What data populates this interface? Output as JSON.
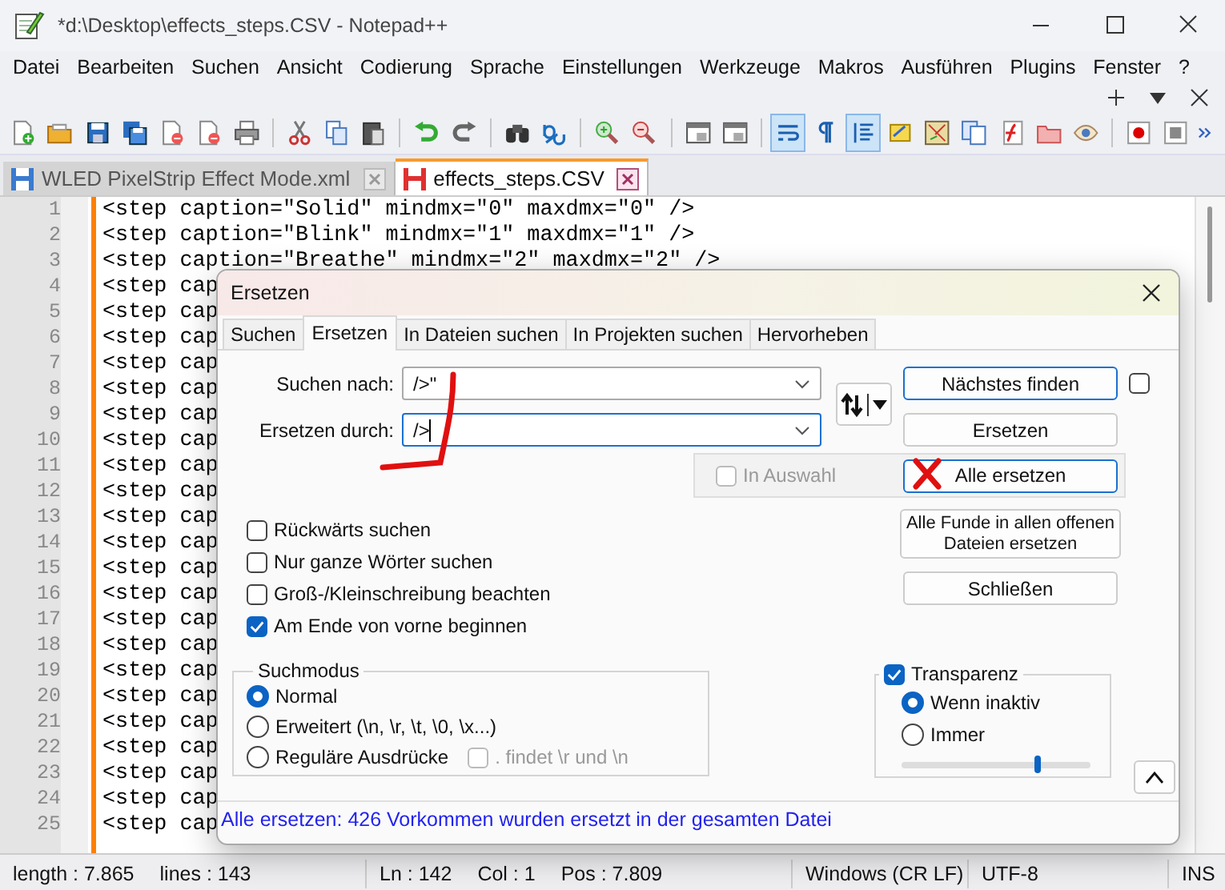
{
  "window": {
    "title": "*d:\\Desktop\\effects_steps.CSV - Notepad++"
  },
  "menu": [
    "Datei",
    "Bearbeiten",
    "Suchen",
    "Ansicht",
    "Codierung",
    "Sprache",
    "Einstellungen",
    "Werkzeuge",
    "Makros",
    "Ausführen",
    "Plugins",
    "Fenster",
    "?"
  ],
  "file_tabs": [
    {
      "label": "WLED PixelStrip Effect Mode.xml",
      "selected": false
    },
    {
      "label": "effects_steps.CSV",
      "selected": true
    }
  ],
  "editor": {
    "lines": [
      {
        "number": "1",
        "text": "<step caption=\"Solid\" mindmx=\"0\" maxdmx=\"0\" />"
      },
      {
        "number": "2",
        "text": "<step caption=\"Blink\" mindmx=\"1\" maxdmx=\"1\" />"
      },
      {
        "number": "3",
        "text": "<step caption=\"Breathe\" mindmx=\"2\" maxdmx=\"2\" />"
      },
      {
        "number": "4",
        "text": "<step cap"
      },
      {
        "number": "5",
        "text": "<step cap"
      },
      {
        "number": "6",
        "text": "<step cap"
      },
      {
        "number": "7",
        "text": "<step cap"
      },
      {
        "number": "8",
        "text": "<step cap"
      },
      {
        "number": "9",
        "text": "<step cap"
      },
      {
        "number": "10",
        "text": "<step cap"
      },
      {
        "number": "11",
        "text": "<step cap"
      },
      {
        "number": "12",
        "text": "<step cap"
      },
      {
        "number": "13",
        "text": "<step cap"
      },
      {
        "number": "14",
        "text": "<step cap"
      },
      {
        "number": "15",
        "text": "<step cap"
      },
      {
        "number": "16",
        "text": "<step cap"
      },
      {
        "number": "17",
        "text": "<step cap"
      },
      {
        "number": "18",
        "text": "<step cap"
      },
      {
        "number": "19",
        "text": "<step cap"
      },
      {
        "number": "20",
        "text": "<step cap"
      },
      {
        "number": "21",
        "text": "<step cap"
      },
      {
        "number": "22",
        "text": "<step cap"
      },
      {
        "number": "23",
        "text": "<step cap"
      },
      {
        "number": "24",
        "text": "<step cap"
      },
      {
        "number": "25",
        "text": "<step cap"
      }
    ]
  },
  "dialog": {
    "title": "Ersetzen",
    "tabs": [
      {
        "label": "Suchen",
        "selected": false
      },
      {
        "label": "Ersetzen",
        "selected": true
      },
      {
        "label": "In Dateien suchen",
        "selected": false
      },
      {
        "label": "In Projekten suchen",
        "selected": false
      },
      {
        "label": "Hervorheben",
        "selected": false
      }
    ],
    "find": {
      "label": "Suchen nach:",
      "value": "/>\""
    },
    "replace": {
      "label": "Ersetzen durch:",
      "value": "/>"
    },
    "find_next": "Nächstes finden",
    "find_next_checkbox": {
      "checked": false
    },
    "replace_button": "Ersetzen",
    "in_selection": {
      "label": "In Auswahl",
      "checked": false
    },
    "replace_all": "Alle ersetzen",
    "replace_all_open": "Alle Funde in allen offenen Dateien ersetzen",
    "close_button": "Schließen",
    "options": [
      {
        "label": "Rückwärts suchen",
        "checked": false
      },
      {
        "label": "Nur ganze Wörter suchen",
        "checked": false
      },
      {
        "label": "Groß-/Kleinschreibung beachten",
        "checked": false
      },
      {
        "label": "Am Ende von vorne beginnen",
        "checked": true
      }
    ],
    "search_mode": {
      "title": "Suchmodus",
      "options": [
        {
          "label": "Normal",
          "selected": true
        },
        {
          "label": "Erweitert (\\n, \\r, \\t, \\0, \\x...)",
          "selected": false
        },
        {
          "label": "Reguläre Ausdrücke",
          "selected": false
        }
      ],
      "dot_matches": {
        "label": ". findet \\r und \\n",
        "checked": false
      }
    },
    "transparency": {
      "label": "Transparenz",
      "checked": true,
      "options": [
        {
          "label": "Wenn inaktiv",
          "selected": true
        },
        {
          "label": "Immer",
          "selected": false
        }
      ],
      "level": 0.72
    },
    "message": "Alle ersetzen: 426 Vorkommen wurden ersetzt in der gesamten Datei"
  },
  "status_bar": [
    {
      "items": [
        "length : 7.865",
        "lines : 143"
      ]
    },
    {
      "items": [
        "Ln : 142",
        "Col : 1",
        "Pos : 7.809"
      ]
    },
    {
      "items": [
        "Windows (CR LF)"
      ]
    },
    {
      "items": [
        "UTF-8"
      ]
    },
    {
      "items": [
        "INS"
      ]
    }
  ]
}
